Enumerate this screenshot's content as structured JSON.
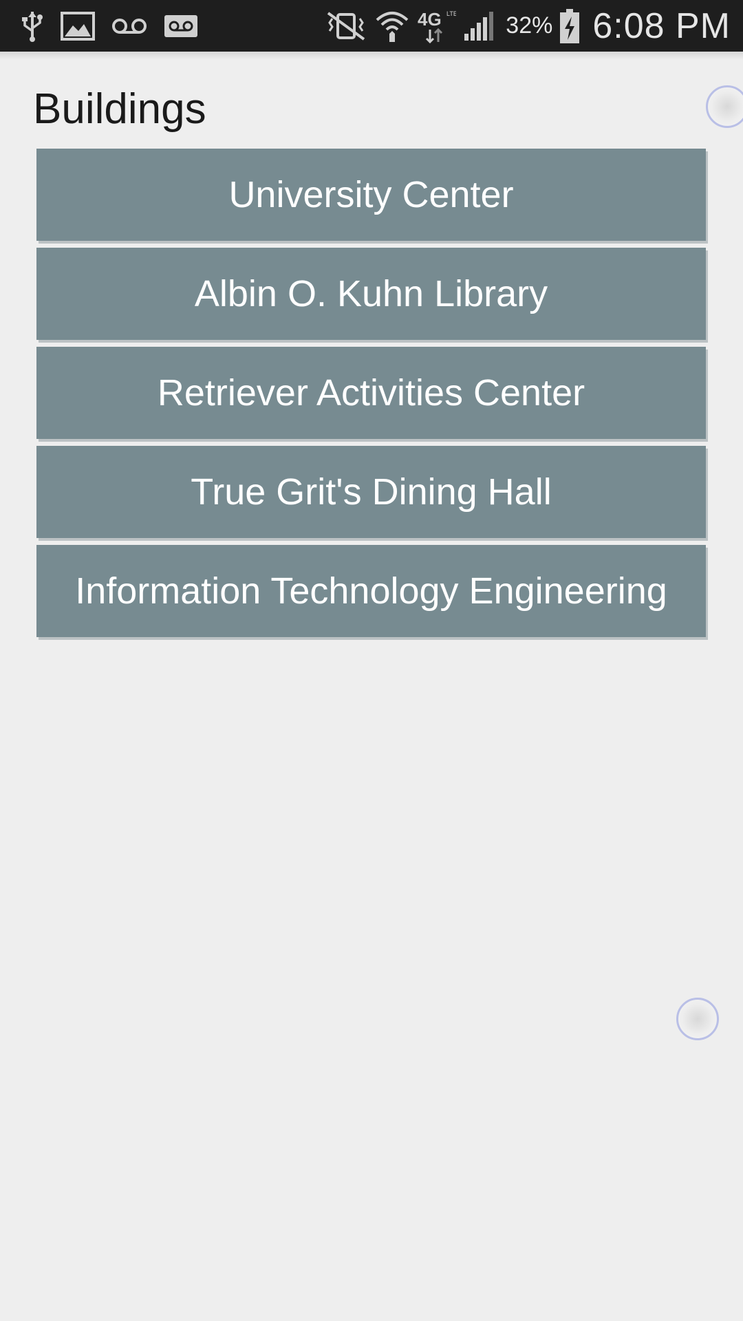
{
  "status_bar": {
    "icons_left": [
      "usb-icon",
      "image-icon",
      "voicemail-icon",
      "voicemail-box-icon"
    ],
    "icons_right": [
      "vibrate-off-icon",
      "wifi-icon",
      "network-4g-lte-icon",
      "signal-icon",
      "battery-charging-icon"
    ],
    "battery_percent": "32%",
    "time": "6:08 PM"
  },
  "page": {
    "title": "Buildings"
  },
  "buildings": [
    {
      "label": "University Center"
    },
    {
      "label": "Albin O. Kuhn Library"
    },
    {
      "label": "Retriever Activities Center"
    },
    {
      "label": "True Grit's Dining Hall"
    },
    {
      "label": "Information Technology Engineering"
    }
  ],
  "colors": {
    "button_background": "#778b91",
    "page_background": "#eeeeee",
    "status_bar_background": "#1e1e1e"
  }
}
